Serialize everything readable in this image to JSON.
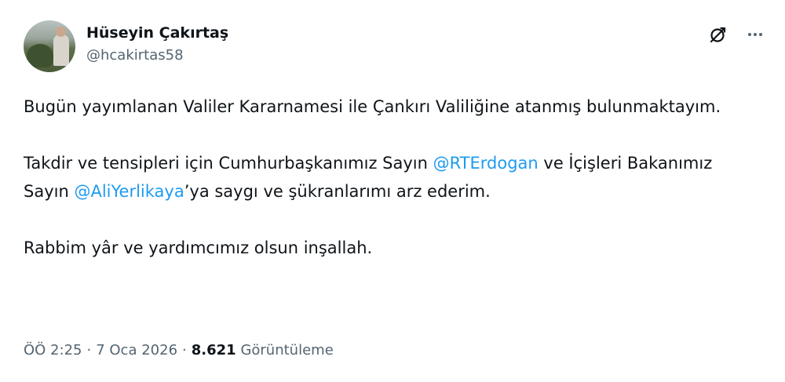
{
  "author": {
    "display_name": "Hüseyin Çakırtaş",
    "handle": "@hcakirtas58"
  },
  "icons": {
    "grok": "slashed-circle-icon",
    "more": "more-icon"
  },
  "tweet": {
    "para1": "Bugün yayımlanan Valiler Kararnamesi ile Çankırı Valiliğine atanmış bulunmaktayım.",
    "para2_part1": "Takdir ve tensipleri için Cumhurbaşkanımız Sayın ",
    "mention1": "@RTErdogan",
    "para2_part2": " ve İçişleri Bakanımız Sayın ",
    "mention2": "@AliYerlikaya",
    "para2_part3": "’ya saygı ve şükranlarımı arz ederim.",
    "para3": "Rabbim yâr ve yardımcımız olsun inşallah."
  },
  "meta": {
    "time": "ÖÖ 2:25",
    "separator": "·",
    "date": "7 Oca 2026",
    "views_count": "8.621",
    "views_label": "Görüntüleme"
  },
  "colors": {
    "mention": "#1d9bf0",
    "secondary_text": "#536471",
    "primary_text": "#0f1419"
  }
}
